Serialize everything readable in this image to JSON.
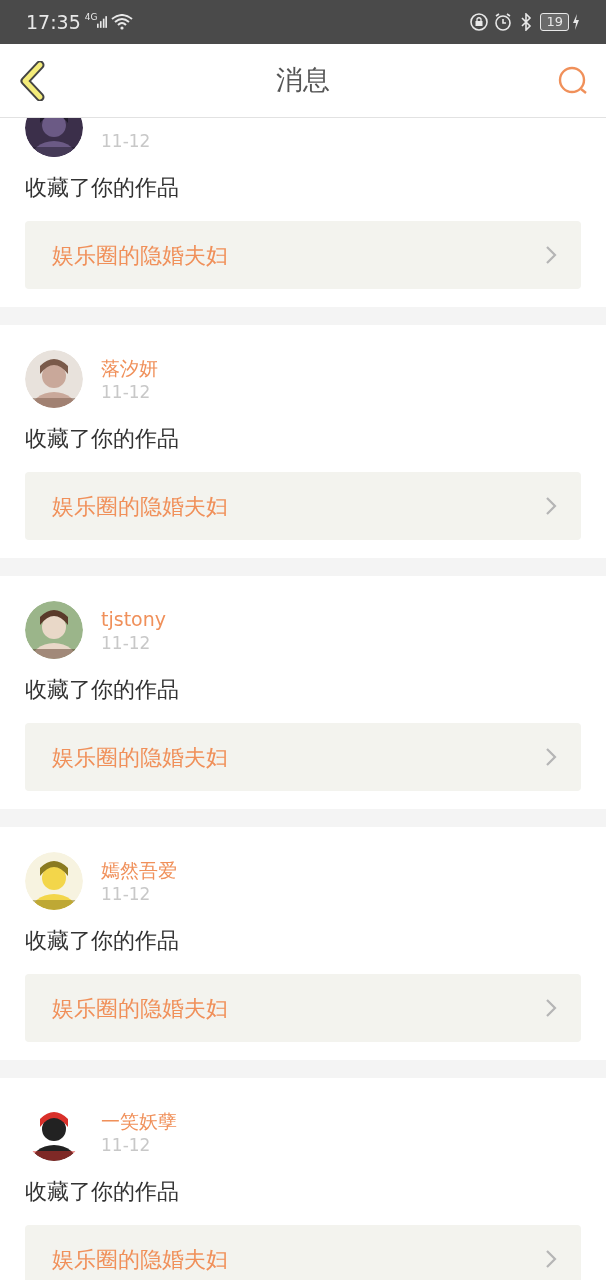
{
  "status_bar": {
    "time": "17:35",
    "network": "4G",
    "battery": "19"
  },
  "header": {
    "title": "消息"
  },
  "messages": [
    {
      "date": "11-12",
      "action": "收藏了你的作品",
      "work": "娱乐圈的隐婚夫妇"
    },
    {
      "name": "落汐妍",
      "date": "11-12",
      "action": "收藏了你的作品",
      "work": "娱乐圈的隐婚夫妇"
    },
    {
      "name": "tjstony",
      "date": "11-12",
      "action": "收藏了你的作品",
      "work": "娱乐圈的隐婚夫妇"
    },
    {
      "name": "嫣然吾爱",
      "date": "11-12",
      "action": "收藏了你的作品",
      "work": "娱乐圈的隐婚夫妇"
    },
    {
      "name": "一笑妖孽",
      "date": "11-12",
      "action": "收藏了你的作品",
      "work": "娱乐圈的隐婚夫妇"
    }
  ]
}
